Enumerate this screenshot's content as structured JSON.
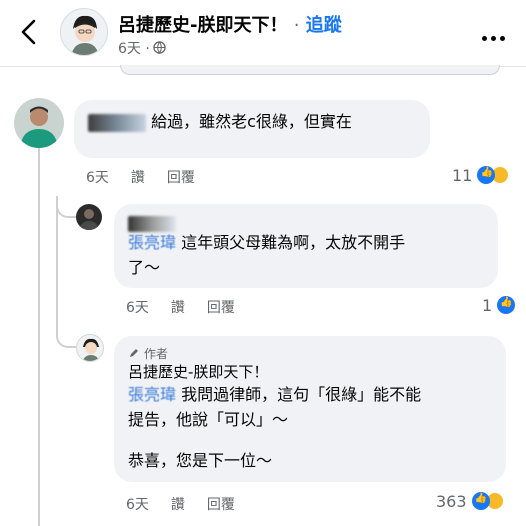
{
  "header": {
    "title": "呂捷歷史-朕即天下！",
    "separator": "·",
    "follow_label": "追蹤",
    "timestamp": "6天 ·"
  },
  "comments": [
    {
      "text": "給過，雖然老c很綠，但實在",
      "actions": [
        "6天",
        "讚",
        "回覆"
      ],
      "reaction_count": "11"
    },
    {
      "tag_name": "張亮瑋",
      "text_line1": "這年頭父母難為啊，太放不開手",
      "text_line2": "了～",
      "actions": [
        "6天",
        "讚",
        "回覆"
      ],
      "reaction_count": "1"
    },
    {
      "author_label": "作者",
      "name": "呂捷歷史-朕即天下！",
      "tag_name": "張亮瑋",
      "text_line1": "我問過律師，這句「很綠」能不能",
      "text_line2": "提告，他說「可以」～",
      "text_line3": "恭喜，您是下一位～",
      "actions": [
        "6天",
        "讚",
        "回覆"
      ],
      "reaction_count": "363"
    }
  ]
}
